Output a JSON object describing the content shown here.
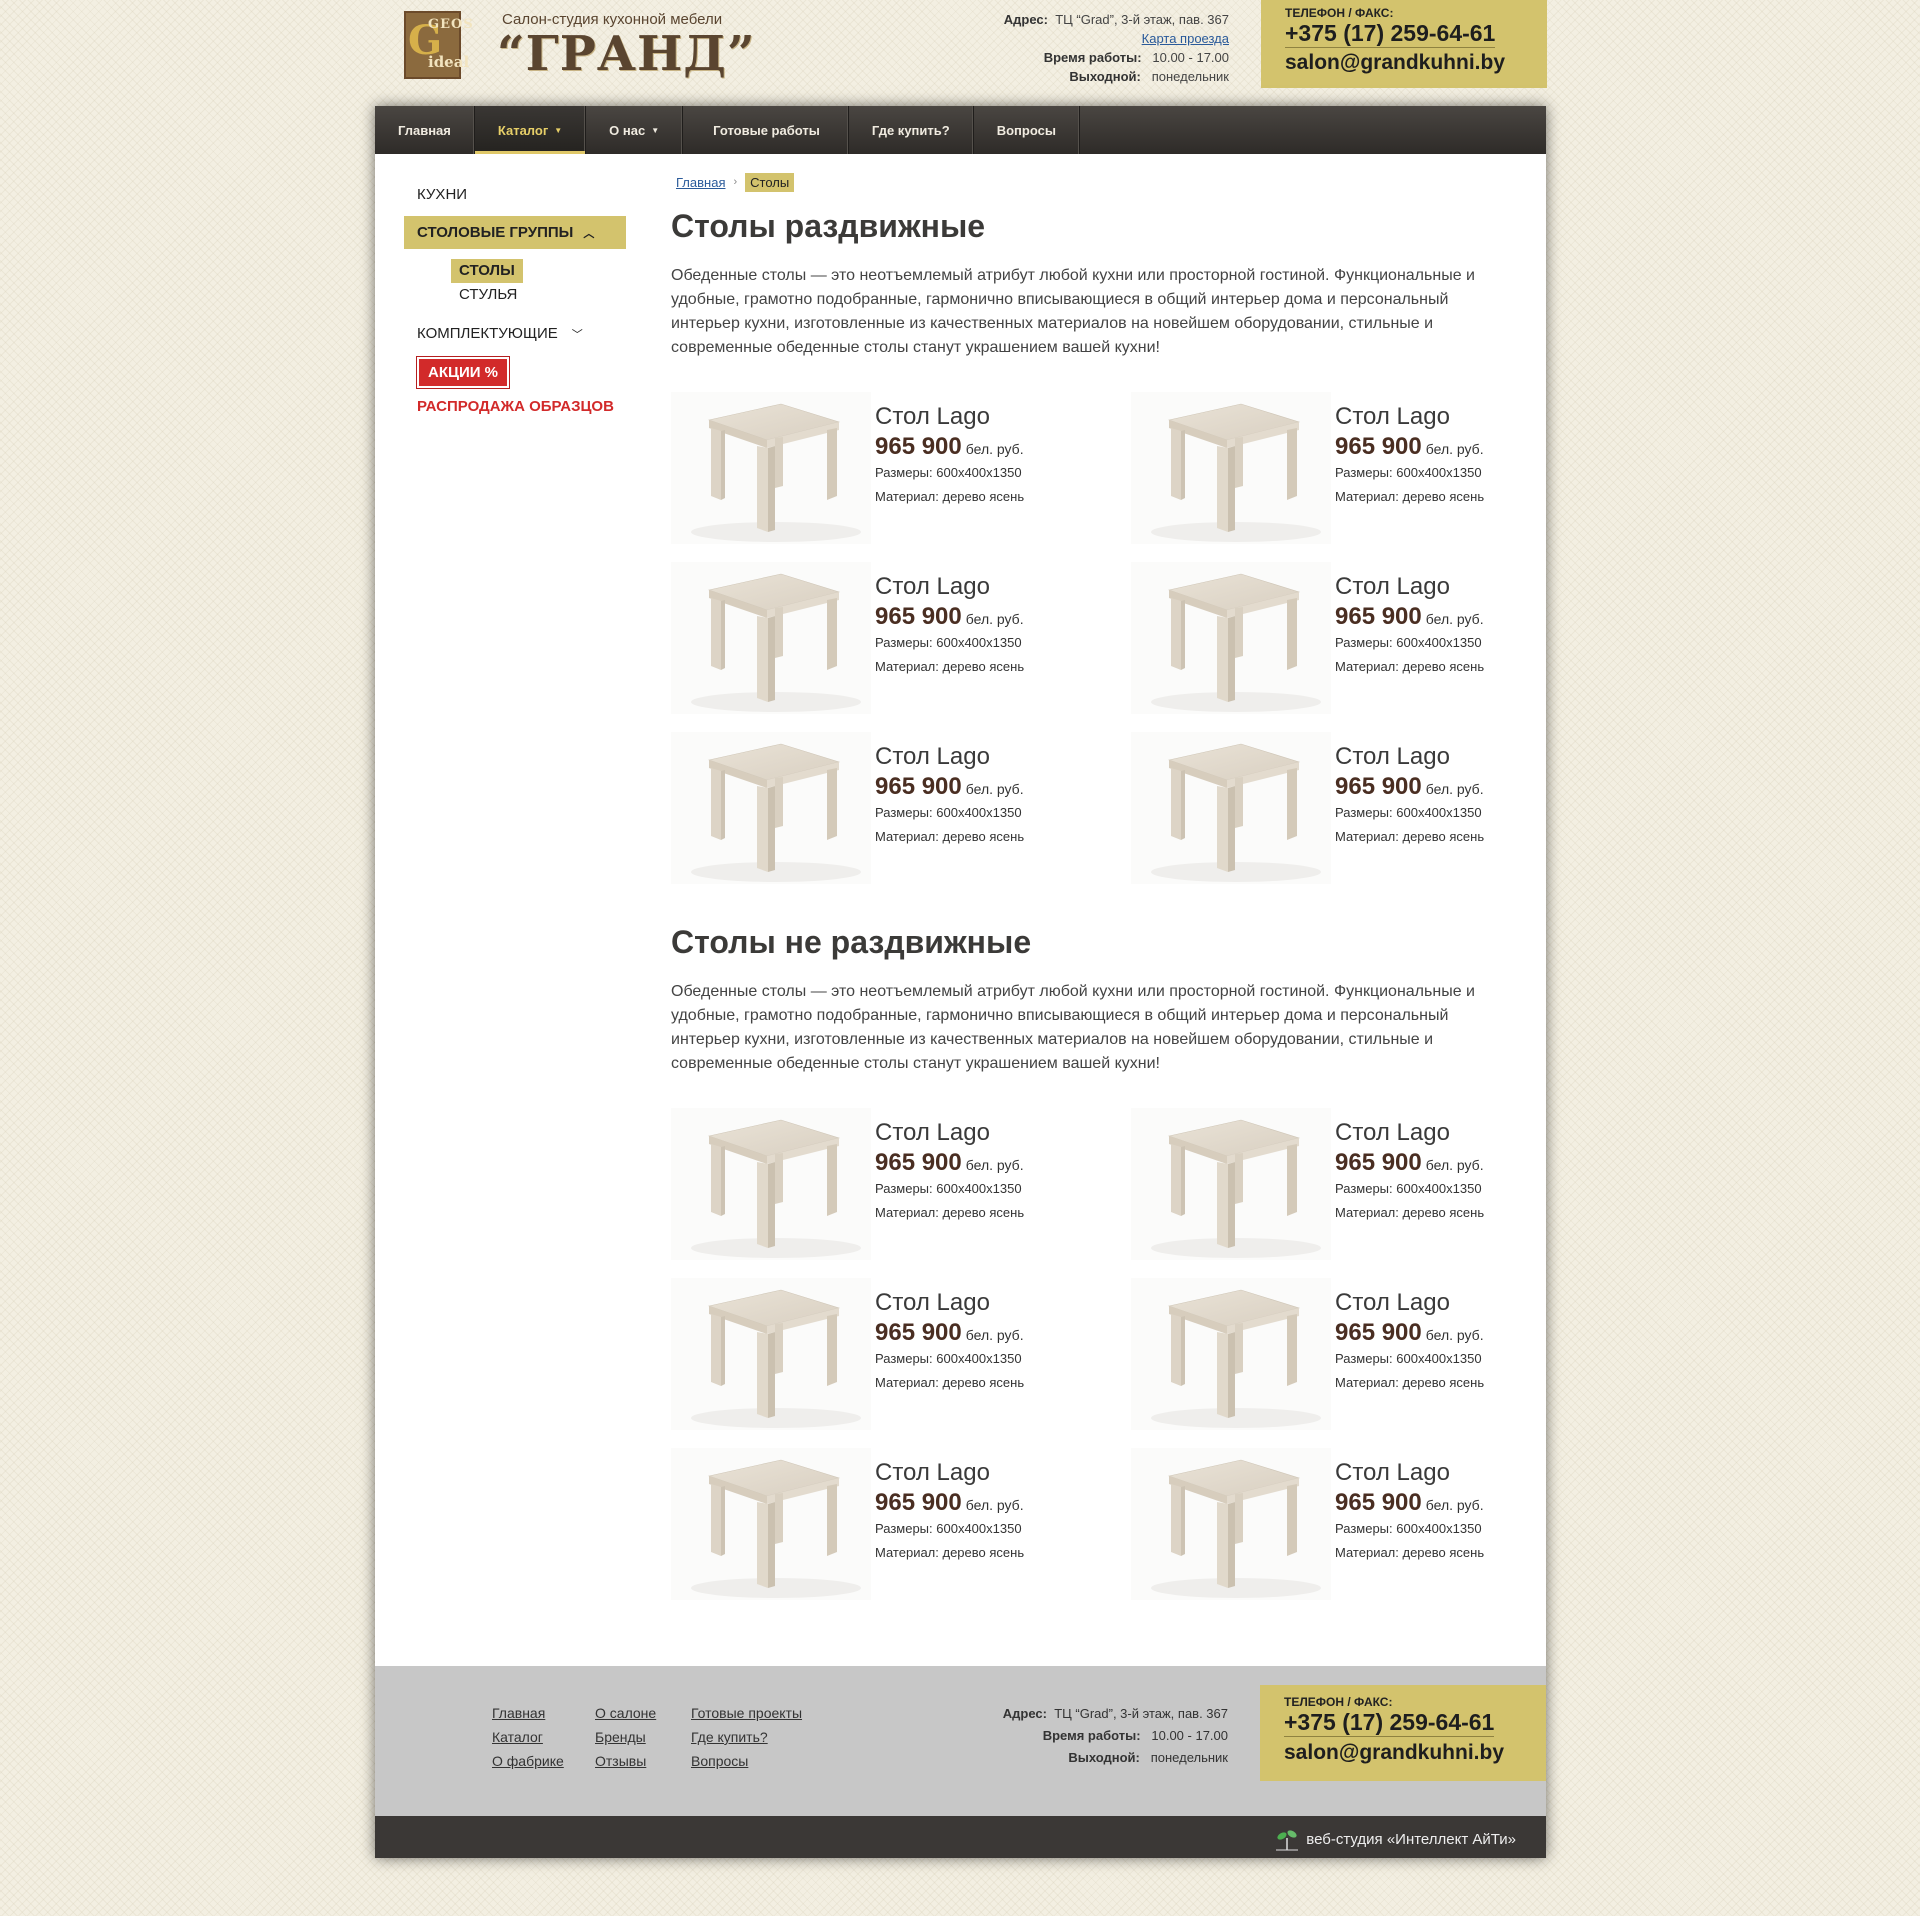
{
  "header": {
    "logo": {
      "g": "G",
      "geos": "GEOS",
      "ideal": "ideal"
    },
    "brand_sub": "Салон-студия кухонной мебели",
    "brand_name": "“ГРАНД”",
    "address_label": "Адрес:",
    "address": "ТЦ “Grad”, 3-й этаж, пав. 367",
    "map_link": "Карта проезда",
    "hours_label": "Время работы:",
    "hours": "10.00 - 17.00",
    "dayoff_label": "Выходной:",
    "dayoff": "понедельник",
    "phone_label": "ТЕЛЕФОН / ФАКС:",
    "phone": "+375 (17) 259-64-61",
    "email": "salon@grandkuhni.by"
  },
  "nav": {
    "items": [
      {
        "label": "Главная"
      },
      {
        "label": "Каталог",
        "caret": "▼"
      },
      {
        "label": "О нас",
        "caret": "▼"
      },
      {
        "label": "Готовые работы"
      },
      {
        "label": "Где купить?"
      },
      {
        "label": "Вопросы"
      }
    ]
  },
  "sidebar": {
    "kitchens": "КУХНИ",
    "dining_groups": "СТОЛОВЫЕ ГРУППЫ",
    "chev_up": "︿",
    "tables": "СТОЛЫ",
    "chairs": "СТУЛЬЯ",
    "components": "КОМПЛЕКТУЮЩИЕ",
    "chev_down": "﹀",
    "sale": "АКЦИИ %",
    "outlet": "РАСПРОДАЖА ОБРАЗЦОВ"
  },
  "breadcrumb": {
    "home": "Главная",
    "sep": "›",
    "current": "Столы"
  },
  "section1": {
    "title": "Столы раздвижные",
    "intro": "Обеденные столы — это неотъемлемый атрибут любой кухни или просторной гостиной. Функциональные и удобные, грамотно подобранные, гармонично вписывающиеся в общий интерьер дома и персональный интерьер кухни, изготовленные из качественных материалов на новейшем оборудовании, стильные и современные обеденные столы станут украшением вашей кухни!",
    "products": [
      {
        "title": "Стол Lago",
        "price": "965 900",
        "currency": "бел. руб.",
        "size": "Размеры: 600х400х1350",
        "material": "Материал: дерево ясень"
      },
      {
        "title": "Стол Lago",
        "price": "965 900",
        "currency": "бел. руб.",
        "size": "Размеры: 600х400х1350",
        "material": "Материал: дерево ясень"
      },
      {
        "title": "Стол Lago",
        "price": "965 900",
        "currency": "бел. руб.",
        "size": "Размеры: 600х400х1350",
        "material": "Материал: дерево ясень"
      },
      {
        "title": "Стол Lago",
        "price": "965 900",
        "currency": "бел. руб.",
        "size": "Размеры: 600х400х1350",
        "material": "Материал: дерево ясень"
      },
      {
        "title": "Стол Lago",
        "price": "965 900",
        "currency": "бел. руб.",
        "size": "Размеры: 600х400х1350",
        "material": "Материал: дерево ясень"
      },
      {
        "title": "Стол Lago",
        "price": "965 900",
        "currency": "бел. руб.",
        "size": "Размеры: 600х400х1350",
        "material": "Материал: дерево ясень"
      }
    ]
  },
  "section2": {
    "title": "Столы не раздвижные",
    "intro": "Обеденные столы — это неотъемлемый атрибут любой кухни или просторной гостиной. Функциональные и удобные, грамотно подобранные, гармонично вписывающиеся в общий интерьер дома и персональный интерьер кухни, изготовленные из качественных материалов на новейшем оборудовании, стильные и современные обеденные столы станут украшением вашей кухни!",
    "products": [
      {
        "title": "Стол Lago",
        "price": "965 900",
        "currency": "бел. руб.",
        "size": "Размеры: 600х400х1350",
        "material": "Материал: дерево ясень"
      },
      {
        "title": "Стол Lago",
        "price": "965 900",
        "currency": "бел. руб.",
        "size": "Размеры: 600х400х1350",
        "material": "Материал: дерево ясень"
      },
      {
        "title": "Стол Lago",
        "price": "965 900",
        "currency": "бел. руб.",
        "size": "Размеры: 600х400х1350",
        "material": "Материал: дерево ясень"
      },
      {
        "title": "Стол Lago",
        "price": "965 900",
        "currency": "бел. руб.",
        "size": "Размеры: 600х400х1350",
        "material": "Материал: дерево ясень"
      },
      {
        "title": "Стол Lago",
        "price": "965 900",
        "currency": "бел. руб.",
        "size": "Размеры: 600х400х1350",
        "material": "Материал: дерево ясень"
      },
      {
        "title": "Стол Lago",
        "price": "965 900",
        "currency": "бел. руб.",
        "size": "Размеры: 600х400х1350",
        "material": "Материал: дерево ясень"
      }
    ]
  },
  "footer": {
    "links": [
      "Главная",
      "О салоне",
      "Готовые проекты",
      "Каталог",
      "Бренды",
      "Где купить?",
      "О фабрике",
      "Отзывы",
      "Вопросы"
    ],
    "address_label": "Адрес:",
    "address": "ТЦ “Grad”, 3-й этаж, пав. 367",
    "hours_label": "Время работы:",
    "hours": "10.00 - 17.00",
    "dayoff_label": "Выходной:",
    "dayoff": "понедельник",
    "phone_label": "ТЕЛЕФОН / ФАКС:",
    "phone": "+375 (17) 259-64-61",
    "email": "salon@grandkuhni.by",
    "studio": "веб-студия «Интеллект АйТи»"
  },
  "colors": {
    "accent": "#d3c36d",
    "nav_bg": "#3b3836",
    "sale_red": "#d22a2a",
    "price_brown": "#4a2e22"
  },
  "icons": [
    "table-product-image",
    "sprout-logo-icon",
    "chevron-up-icon",
    "chevron-down-icon",
    "caret-down-icon"
  ]
}
